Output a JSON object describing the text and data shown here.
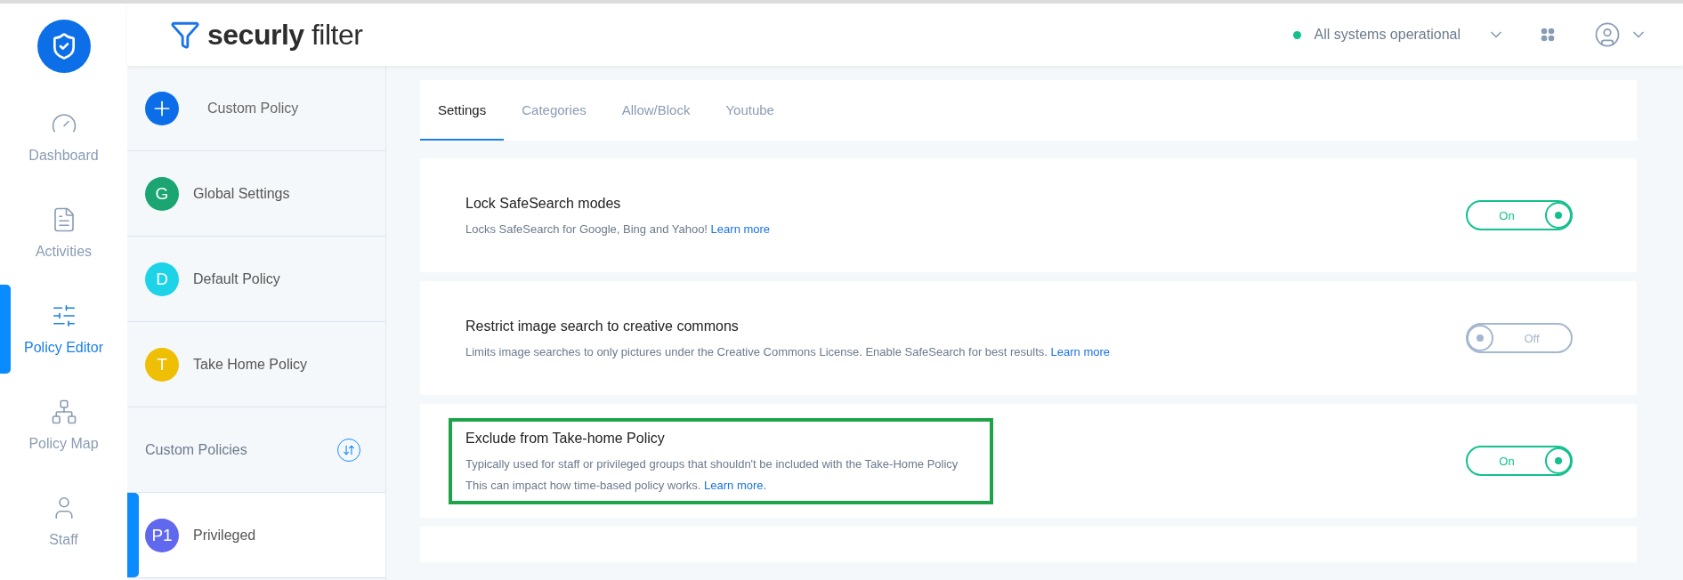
{
  "nav": [
    {
      "label": "Dashboard",
      "kind": "gauge",
      "selected": false
    },
    {
      "label": "Activities",
      "kind": "document",
      "selected": false
    },
    {
      "label": "Policy Editor",
      "kind": "sliders",
      "selected": true
    },
    {
      "label": "Policy Map",
      "kind": "hierarchy",
      "selected": false
    },
    {
      "label": "Staff",
      "kind": "person",
      "selected": false
    }
  ],
  "brand": "**securly** filter",
  "status": {
    "text": "All systems operational",
    "color": "#13c08e"
  },
  "policies": [
    {
      "kind": "add",
      "label": "Custom Policy"
    },
    {
      "kind": "policy",
      "badge": "G",
      "label": "Global Settings",
      "color": "#1aa572",
      "selected": false
    },
    {
      "kind": "policy",
      "badge": "D",
      "label": "Default Policy",
      "color": "#1cd3e8",
      "selected": false
    },
    {
      "kind": "policy",
      "badge": "T",
      "label": "Take Home Policy",
      "color": "#eebf04",
      "selected": false
    },
    {
      "kind": "section",
      "label": "Custom Policies"
    },
    {
      "kind": "policy",
      "badge": "P1",
      "label": "Privileged",
      "color": "#6068ee",
      "selected": true
    }
  ],
  "tabs": [
    {
      "label": "Settings",
      "selected": true
    },
    {
      "label": "Categories",
      "selected": false
    },
    {
      "label": "Allow/Block",
      "selected": false
    },
    {
      "label": "Youtube",
      "selected": false
    }
  ],
  "settings": [
    {
      "title": "Lock SafeSearch modes",
      "lines": [
        {
          "text": "Locks SafeSearch for Google, Bing and Yahoo!",
          "link": "Learn more"
        }
      ],
      "on": true,
      "toggle": "On",
      "highlighted": false
    },
    {
      "title": "Restrict image search to creative commons",
      "lines": [
        {
          "text": "Limits image searches to only pictures under the Creative Commons License. Enable SafeSearch for best results.",
          "link": "Learn more"
        }
      ],
      "on": false,
      "toggle": "Off",
      "highlighted": false
    },
    {
      "title": "Exclude from Take-home Policy",
      "lines": [
        {
          "text": "Typically used for staff or privileged groups that shouldn't be included with the Take-Home Policy"
        },
        {
          "text": "This can impact how time-based policy works.",
          "link": "Learn more."
        }
      ],
      "on": true,
      "toggle": "On",
      "highlighted": true
    }
  ]
}
